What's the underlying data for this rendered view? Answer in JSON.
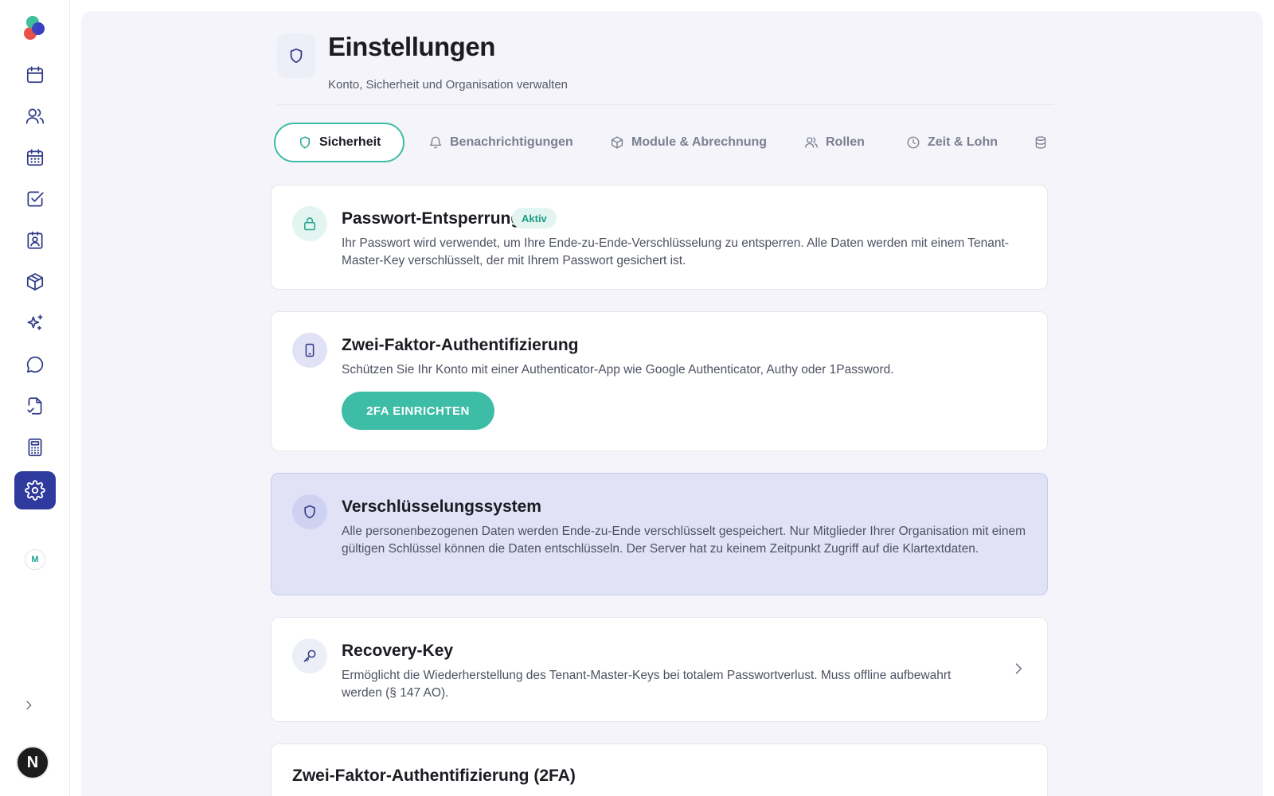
{
  "sidebar": {
    "items": [
      {
        "icon": "calendar-icon"
      },
      {
        "icon": "users-icon"
      },
      {
        "icon": "calendar-grid-icon"
      },
      {
        "icon": "checkbox-icon"
      },
      {
        "icon": "contact-card-icon"
      },
      {
        "icon": "package-icon"
      },
      {
        "icon": "sparkles-icon"
      },
      {
        "icon": "chat-icon"
      },
      {
        "icon": "document-sign-icon"
      },
      {
        "icon": "calculator-icon"
      },
      {
        "icon": "gear-icon",
        "active": true
      }
    ],
    "workspace_initial": "M",
    "user_initial": "N"
  },
  "header": {
    "title": "Einstellungen",
    "subtitle": "Konto, Sicherheit und Organisation verwalten"
  },
  "tabs": [
    {
      "label": "Sicherheit",
      "icon": "shield-icon",
      "active": true
    },
    {
      "label": "Benachrichtigungen",
      "icon": "bell-icon"
    },
    {
      "label": "Module & Abrechnung",
      "icon": "package-icon"
    },
    {
      "label": "Rollen",
      "icon": "users-icon"
    },
    {
      "label": "Zeit & Lohn",
      "icon": "clock-icon"
    },
    {
      "label": "",
      "icon": "database-icon"
    }
  ],
  "cards": {
    "password": {
      "title": "Passwort-Entsperrung",
      "badge": "Aktiv",
      "description": "Ihr Passwort wird verwendet, um Ihre Ende-zu-Ende-Verschlüsselung zu entsperren. Alle Daten werden mit einem Tenant-Master-Key verschlüsselt, der mit Ihrem Passwort gesichert ist."
    },
    "twofa": {
      "title": "Zwei-Faktor-Authentifizierung",
      "description": "Schützen Sie Ihr Konto mit einer Authenticator-App wie Google Authenticator, Authy oder 1Password.",
      "button": "2FA EINRICHTEN"
    },
    "encryption": {
      "title": "Verschlüsselungssystem",
      "description": "Alle personenbezogenen Daten werden Ende-zu-Ende verschlüsselt gespeichert. Nur Mitglieder Ihrer Organisation mit einem gültigen Schlüssel können die Daten entschlüsseln. Der Server hat zu keinem Zeitpunkt Zugriff auf die Klartextdaten."
    },
    "recovery": {
      "title": "Recovery-Key",
      "description": "Ermöglicht die Wiederherstellung des Tenant-Master-Keys bei totalem Passwortverlust. Muss offline aufbewahrt werden (§ 147 AO)."
    },
    "twofa_section": {
      "title": "Zwei-Faktor-Authentifizierung (2FA)"
    }
  },
  "colors": {
    "accent": "#3dbca6",
    "brand": "#2f3a9e",
    "highlight_bg": "#e1e2f6",
    "badge_bg": "#e3f5f0"
  }
}
